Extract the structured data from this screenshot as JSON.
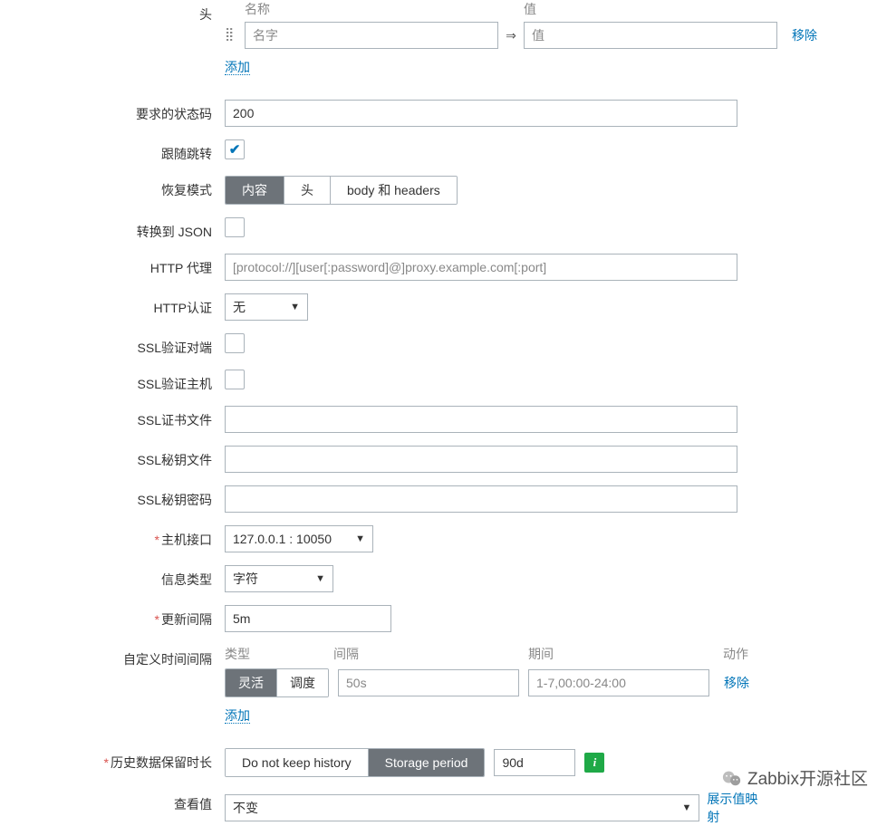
{
  "headers": {
    "label": "头",
    "col_name": "名称",
    "col_value": "值",
    "name_placeholder": "名字",
    "value_placeholder": "值",
    "arrow": "⇒",
    "remove": "移除",
    "add": "添加"
  },
  "status_codes": {
    "label": "要求的状态码",
    "value": "200"
  },
  "follow_redirects": {
    "label": "跟随跳转"
  },
  "retrieve_mode": {
    "label": "恢复模式",
    "options": [
      "内容",
      "头",
      "body 和 headers"
    ],
    "selected": "内容"
  },
  "to_json": {
    "label": "转换到 JSON"
  },
  "http_proxy": {
    "label": "HTTP 代理",
    "placeholder": "[protocol://][user[:password]@]proxy.example.com[:port]"
  },
  "http_auth": {
    "label": "HTTP认证",
    "options": [
      "无"
    ],
    "selected": "无"
  },
  "ssl_verify_peer": {
    "label": "SSL验证对端"
  },
  "ssl_verify_host": {
    "label": "SSL验证主机"
  },
  "ssl_cert_file": {
    "label": "SSL证书文件",
    "value": ""
  },
  "ssl_key_file": {
    "label": "SSL秘钥文件",
    "value": ""
  },
  "ssl_key_pw": {
    "label": "SSL秘钥密码",
    "value": ""
  },
  "host_if": {
    "label": "主机接口",
    "selected": "127.0.0.1 : 10050"
  },
  "info_type": {
    "label": "信息类型",
    "selected": "字符"
  },
  "update_interval": {
    "label": "更新间隔",
    "value": "5m"
  },
  "custom_intervals": {
    "label": "自定义时间间隔",
    "col_type": "类型",
    "col_interval": "间隔",
    "col_period": "期间",
    "col_action": "动作",
    "type_options": [
      "灵活",
      "调度"
    ],
    "type_selected": "灵活",
    "interval_placeholder": "50s",
    "period_placeholder": "1-7,00:00-24:00",
    "remove": "移除",
    "add": "添加"
  },
  "history": {
    "label": "历史数据保留时长",
    "options": [
      "Do not keep history",
      "Storage period"
    ],
    "selected": "Storage period",
    "value": "90d"
  },
  "view_value": {
    "label": "查看值",
    "selected": "不变",
    "link": "展示值映射"
  },
  "brand": "Zabbix开源社区"
}
